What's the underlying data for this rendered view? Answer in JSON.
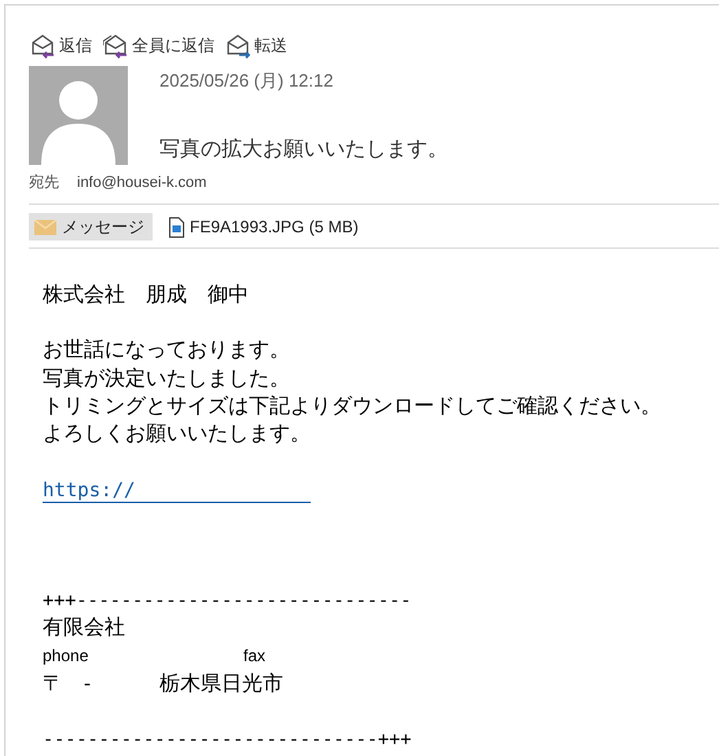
{
  "toolbar": [
    {
      "kind": "reply",
      "label": "返信"
    },
    {
      "kind": "reply_all",
      "label": "全員に返信"
    },
    {
      "kind": "forward",
      "label": "転送"
    }
  ],
  "header": {
    "date": "2025/05/26 (月) 12:12",
    "subject": "写真の拡大お願いいたします。",
    "to_label": "宛先",
    "to": "info@housei-k.com"
  },
  "tabs": [
    {
      "kind": "message",
      "label": "メッセージ",
      "selected": true
    },
    {
      "kind": "attachment",
      "label": "FE9A1993.JPG (5 MB)",
      "selected": false
    }
  ],
  "body": [
    {
      "kind": "text",
      "text": "株式会社　朋成　御中"
    },
    {
      "kind": "blank"
    },
    {
      "kind": "text",
      "text": "お世話になっております。"
    },
    {
      "kind": "text",
      "text": "写真が決定いたしました。"
    },
    {
      "kind": "text",
      "text": "トリミングとサイズは下記よりダウンロードしてご確認ください。"
    },
    {
      "kind": "text",
      "text": "よろしくお願いいたします。"
    },
    {
      "kind": "blank"
    },
    {
      "kind": "link",
      "text": "https://"
    },
    {
      "kind": "blank"
    },
    {
      "kind": "blank"
    },
    {
      "kind": "blank"
    },
    {
      "kind": "rule",
      "text": "+++------------------------------"
    },
    {
      "kind": "text",
      "text": "有限会社"
    },
    {
      "kind": "fields",
      "small": true,
      "items": [
        "phone",
        "fax"
      ]
    },
    {
      "kind": "fields",
      "small": false,
      "items": [
        "〒",
        "-",
        "栃木県日光市"
      ]
    },
    {
      "kind": "blank"
    },
    {
      "kind": "rule",
      "text": "------------------------------+++"
    }
  ]
}
